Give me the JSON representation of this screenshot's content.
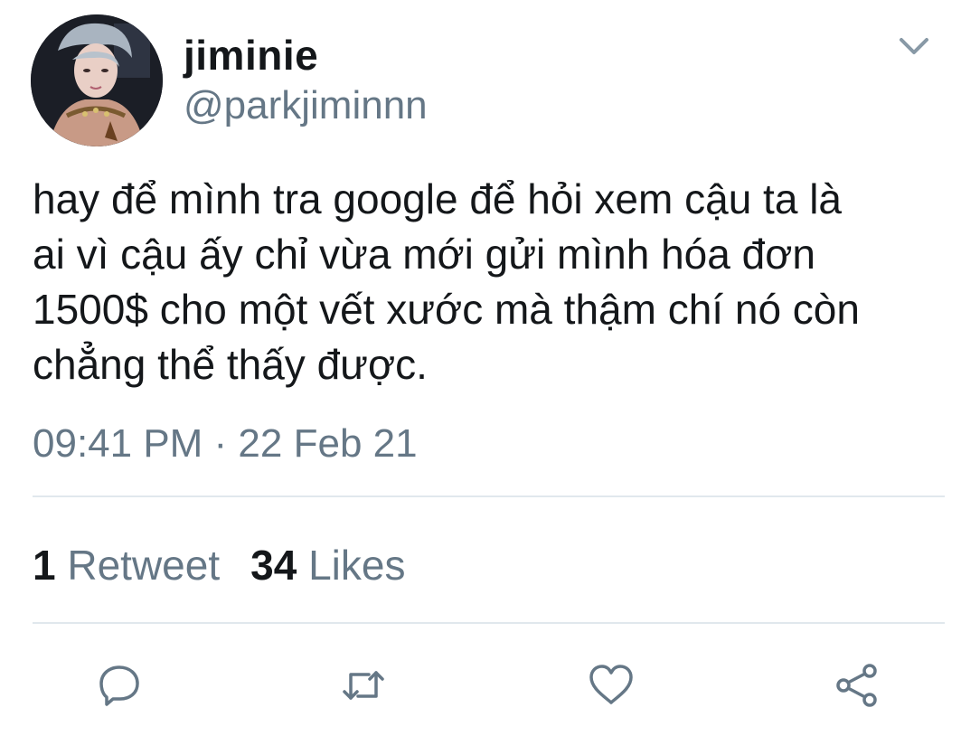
{
  "user": {
    "display_name": "jiminie",
    "handle": "@parkjiminnn"
  },
  "tweet": {
    "text": "hay để mình tra google để hỏi xem cậu ta là\nai vì cậu ấy chỉ vừa mới gửi mình hóa đơn\n1500$ cho một vết xước mà thậm chí nó còn\nchẳng thể thấy được.",
    "timestamp": "09:41 PM · 22 Feb 21"
  },
  "stats": {
    "retweets_count": "1",
    "retweets_label": "Retweet",
    "likes_count": "34",
    "likes_label": "Likes"
  },
  "icons": {
    "menu": "chevron-down-icon",
    "reply": "reply-icon",
    "retweet": "retweet-icon",
    "like": "heart-icon",
    "share": "share-icon"
  },
  "colors": {
    "text_primary": "#14171a",
    "text_secondary": "#657786",
    "icon": "#657786",
    "divider": "#e1e8ed"
  }
}
